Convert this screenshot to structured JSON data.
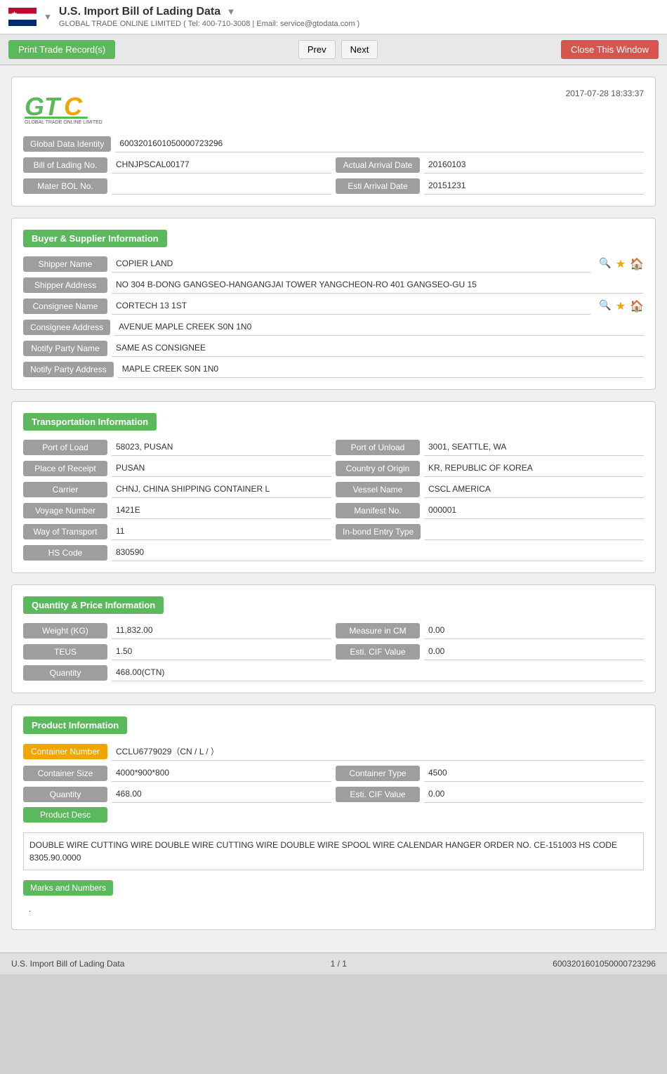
{
  "app": {
    "title": "U.S. Import Bill of Lading Data",
    "title_arrow": "▼",
    "subtitle": "GLOBAL TRADE ONLINE LIMITED ( Tel: 400-710-3008 | Email: service@gtodata.com )",
    "timestamp": "2017-07-28 18:33:37"
  },
  "toolbar": {
    "print_label": "Print Trade Record(s)",
    "prev_label": "Prev",
    "next_label": "Next",
    "close_label": "Close This Window"
  },
  "identity": {
    "global_data_identity_label": "Global Data Identity",
    "global_data_identity_value": "6003201601050000723296",
    "bill_of_lading_label": "Bill of Lading No.",
    "bill_of_lading_value": "CHNJPSCAL00177",
    "actual_arrival_label": "Actual Arrival Date",
    "actual_arrival_value": "20160103",
    "mater_bol_label": "Mater BOL No.",
    "mater_bol_value": "",
    "esti_arrival_label": "Esti Arrival Date",
    "esti_arrival_value": "20151231"
  },
  "buyer_supplier": {
    "section_title": "Buyer & Supplier Information",
    "shipper_name_label": "Shipper Name",
    "shipper_name_value": "COPIER LAND",
    "shipper_address_label": "Shipper Address",
    "shipper_address_value": "NO 304 B-DONG GANGSEO-HANGANGJAI TOWER YANGCHEON-RO 401 GANGSEO-GU 15",
    "consignee_name_label": "Consignee Name",
    "consignee_name_value": "CORTECH 13 1ST",
    "consignee_address_label": "Consignee Address",
    "consignee_address_value": "AVENUE MAPLE CREEK S0N 1N0",
    "notify_party_name_label": "Notify Party Name",
    "notify_party_name_value": "SAME AS CONSIGNEE",
    "notify_party_address_label": "Notify Party Address",
    "notify_party_address_value": "MAPLE CREEK S0N 1N0"
  },
  "transportation": {
    "section_title": "Transportation Information",
    "port_of_load_label": "Port of Load",
    "port_of_load_value": "58023, PUSAN",
    "port_of_unload_label": "Port of Unload",
    "port_of_unload_value": "3001, SEATTLE, WA",
    "place_of_receipt_label": "Place of Receipt",
    "place_of_receipt_value": "PUSAN",
    "country_of_origin_label": "Country of Origin",
    "country_of_origin_value": "KR, REPUBLIC OF KOREA",
    "carrier_label": "Carrier",
    "carrier_value": "CHNJ, CHINA SHIPPING CONTAINER L",
    "vessel_name_label": "Vessel Name",
    "vessel_name_value": "CSCL AMERICA",
    "voyage_number_label": "Voyage Number",
    "voyage_number_value": "1421E",
    "manifest_no_label": "Manifest No.",
    "manifest_no_value": "000001",
    "way_of_transport_label": "Way of Transport",
    "way_of_transport_value": "11",
    "inbond_entry_label": "In-bond Entry Type",
    "inbond_entry_value": "",
    "hs_code_label": "HS Code",
    "hs_code_value": "830590"
  },
  "quantity_price": {
    "section_title": "Quantity & Price Information",
    "weight_kg_label": "Weight (KG)",
    "weight_kg_value": "11,832.00",
    "measure_cm_label": "Measure in CM",
    "measure_cm_value": "0.00",
    "teus_label": "TEUS",
    "teus_value": "1.50",
    "esti_cif_label": "Esti. CIF Value",
    "esti_cif_value": "0.00",
    "quantity_label": "Quantity",
    "quantity_value": "468.00(CTN)"
  },
  "product": {
    "section_title": "Product Information",
    "container_number_label": "Container Number",
    "container_number_value": "CCLU6779029（CN / L / ）",
    "container_size_label": "Container Size",
    "container_size_value": "4000*900*800",
    "container_type_label": "Container Type",
    "container_type_value": "4500",
    "quantity_label": "Quantity",
    "quantity_value": "468.00",
    "esti_cif_label": "Esti. CIF Value",
    "esti_cif_value": "0.00",
    "product_desc_label": "Product Desc",
    "product_desc_value": "DOUBLE WIRE CUTTING WIRE DOUBLE WIRE CUTTING WIRE DOUBLE WIRE SPOOL WIRE CALENDAR HANGER ORDER NO. CE-151003 HS CODE 8305.90.0000",
    "marks_numbers_label": "Marks and Numbers",
    "marks_numbers_value": "."
  },
  "footer": {
    "left": "U.S. Import Bill of Lading Data",
    "center": "1 / 1",
    "right": "6003201601050000723296"
  }
}
